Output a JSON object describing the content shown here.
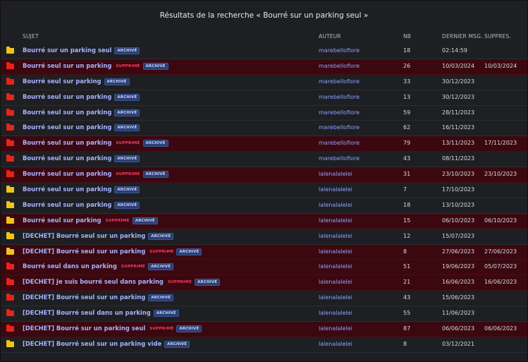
{
  "title": "Résultats de la recherche « Bourré sur un parking seul »",
  "columns": {
    "subject": "SUJET",
    "author": "AUTEUR",
    "nb": "NB",
    "last": "DERNIER MSG.",
    "deleted": "SUPPRES."
  },
  "badges": {
    "deleted": "SUPPRIMÉ",
    "archived": "ARCHIVÉ"
  },
  "colors": {
    "folder_yellow": "#f0c419",
    "folder_red": "#e5241b",
    "deleted_row": "#3b0810"
  },
  "rows": [
    {
      "folder": "yellow",
      "subject": "Bourré sur un parking seul",
      "deleted": false,
      "author": "marebellofiore",
      "nb": "18",
      "last": "02:14:59",
      "supp": ""
    },
    {
      "folder": "red",
      "subject": "Bourré seul sur un parking",
      "deleted": true,
      "author": "marebellofiore",
      "nb": "26",
      "last": "10/03/2024",
      "supp": "10/03/2024"
    },
    {
      "folder": "red",
      "subject": "Bourré seul sur parking",
      "deleted": false,
      "author": "marebellofiore",
      "nb": "33",
      "last": "30/12/2023",
      "supp": ""
    },
    {
      "folder": "red",
      "subject": "Bourré seul sur un parking",
      "deleted": false,
      "author": "marebellofiore",
      "nb": "13",
      "last": "30/12/2023",
      "supp": ""
    },
    {
      "folder": "red",
      "subject": "Bourré seul sur un parking",
      "deleted": false,
      "author": "marebellofiore",
      "nb": "59",
      "last": "28/11/2023",
      "supp": ""
    },
    {
      "folder": "red",
      "subject": "Bourré seul sur un parking",
      "deleted": false,
      "author": "marebellofiore",
      "nb": "62",
      "last": "16/11/2023",
      "supp": ""
    },
    {
      "folder": "red",
      "subject": "Bourré seul sur un parking",
      "deleted": true,
      "author": "marebellofiore",
      "nb": "79",
      "last": "13/11/2023",
      "supp": "17/11/2023"
    },
    {
      "folder": "red",
      "subject": "Bourré seul sur un parking",
      "deleted": false,
      "author": "marebellofiore",
      "nb": "43",
      "last": "08/11/2023",
      "supp": ""
    },
    {
      "folder": "red",
      "subject": "Bourré seul sur un parking",
      "deleted": true,
      "author": "lalenalalelei",
      "nb": "31",
      "last": "23/10/2023",
      "supp": "23/10/2023"
    },
    {
      "folder": "yellow",
      "subject": "Bourré seul sur un parking",
      "deleted": false,
      "author": "lalenalalelei",
      "nb": "7",
      "last": "17/10/2023",
      "supp": ""
    },
    {
      "folder": "yellow",
      "subject": "Bourré seul sur un parking",
      "deleted": false,
      "author": "lalenalalelei",
      "nb": "18",
      "last": "13/10/2023",
      "supp": ""
    },
    {
      "folder": "yellow",
      "subject": "Bourré seul sur parking",
      "deleted": true,
      "author": "lalenalalelei",
      "nb": "15",
      "last": "06/10/2023",
      "supp": "06/10/2023"
    },
    {
      "folder": "yellow",
      "subject": "[DECHET] Bourré seul sur un parking",
      "deleted": false,
      "author": "lalenalalelei",
      "nb": "12",
      "last": "15/07/2023",
      "supp": ""
    },
    {
      "folder": "yellow",
      "subject": "[DECHET] Bourré seul sur un parking",
      "deleted": true,
      "author": "lalenalalelei",
      "nb": "8",
      "last": "27/06/2023",
      "supp": "27/06/2023"
    },
    {
      "folder": "red",
      "subject": "Bourré seul dans un parking",
      "deleted": true,
      "author": "lalenalalelei",
      "nb": "51",
      "last": "19/06/2023",
      "supp": "05/07/2023"
    },
    {
      "folder": "red",
      "subject": "[DECHET] Je suis bourré seul dans parking",
      "deleted": true,
      "author": "lalenalalelei",
      "nb": "21",
      "last": "16/06/2023",
      "supp": "16/06/2023"
    },
    {
      "folder": "red",
      "subject": "[DECHET] Bourré seul sur un parking",
      "deleted": false,
      "author": "lalenalalelei",
      "nb": "43",
      "last": "15/06/2023",
      "supp": ""
    },
    {
      "folder": "red",
      "subject": "[DECHET] Bourré seul dans un parking",
      "deleted": false,
      "author": "lalenalalelei",
      "nb": "55",
      "last": "11/06/2023",
      "supp": ""
    },
    {
      "folder": "red",
      "subject": "[DECHET] Bourré sur un parking seul",
      "deleted": true,
      "author": "lalenalalelei",
      "nb": "87",
      "last": "06/06/2023",
      "supp": "06/06/2023"
    },
    {
      "folder": "yellow",
      "subject": "[DECHET] Bourré seul sur un parking vide",
      "deleted": false,
      "author": "lalenalalelei",
      "nb": "8",
      "last": "03/12/2021",
      "supp": ""
    }
  ]
}
